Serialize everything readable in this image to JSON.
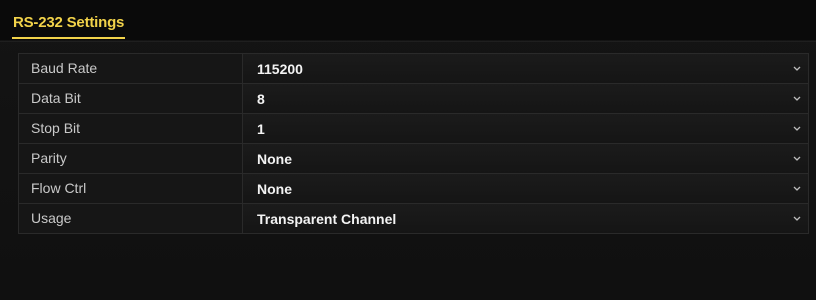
{
  "tab": {
    "title": "RS-232 Settings"
  },
  "settings": [
    {
      "label": "Baud Rate",
      "value": "115200"
    },
    {
      "label": "Data Bit",
      "value": "8"
    },
    {
      "label": "Stop Bit",
      "value": "1"
    },
    {
      "label": "Parity",
      "value": "None"
    },
    {
      "label": "Flow Ctrl",
      "value": "None"
    },
    {
      "label": "Usage",
      "value": "Transparent Channel"
    }
  ],
  "colors": {
    "accent": "#f2d34a",
    "background": "#0c0c0c"
  },
  "icons": {
    "dropdown": "chevron-down-icon"
  }
}
